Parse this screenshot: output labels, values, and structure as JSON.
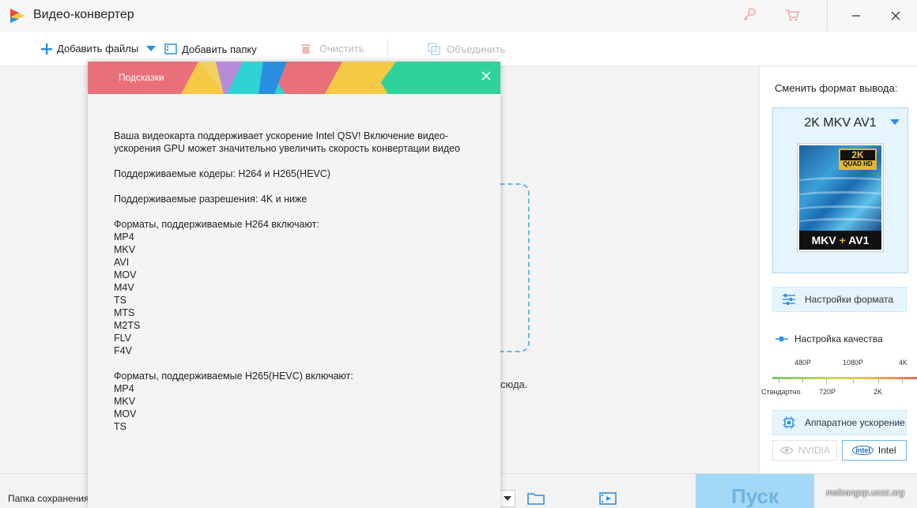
{
  "app": {
    "title": "Видео-конвертер"
  },
  "toolbar": {
    "add_files": "Добавить файлы",
    "add_folder": "Добавить папку",
    "clear": "Очистить",
    "merge": "Объединить"
  },
  "main": {
    "drop_hint_tail": "сюда."
  },
  "dialog": {
    "title": "Подсказки",
    "intro": "Ваша видеокарта поддерживает ускорение Intel QSV! Включение видео-ускорения GPU может значительно увеличить скорость конвертации видео",
    "codecs": "Поддерживаемые кодеры: H264 и H265(HEVC)",
    "resolutions": "Поддерживаемые разрешения: 4K и ниже",
    "h264_heading": "Форматы, поддерживаемые H264 включают:",
    "h264_formats": [
      "MP4",
      "MKV",
      "AVI",
      "MOV",
      "M4V",
      "TS",
      "MTS",
      "M2TS",
      "FLV",
      "F4V"
    ],
    "h265_heading": "Форматы, поддерживаемые H265(HEVC) включают:",
    "h265_formats": [
      "MP4",
      "MKV",
      "MOV",
      "TS"
    ]
  },
  "right_panel": {
    "title": "Сменить формат вывода:",
    "format_name": "2K MKV AV1",
    "thumb": {
      "badge_top": "2K",
      "badge_bottom": "QUAD HD",
      "label_left": "MKV",
      "label_plus": "+",
      "label_right": "AV1"
    },
    "format_settings": "Настройки формата",
    "quality_title": "Настройка качества",
    "quality_top": [
      "480P",
      "1080P",
      "4K"
    ],
    "quality_bottom": [
      "Стандартно",
      "720P",
      "2K"
    ],
    "hw_accel": "Аппаратное ускорение",
    "gpu_nvidia": "NVIDIA",
    "gpu_intel": "Intel",
    "intel_badge": "intel"
  },
  "bottom": {
    "save_folder": "Папка сохранения",
    "start": "Пуск",
    "watermark": "maloangxp.ucoz.org"
  },
  "colors": {
    "accent": "#2b8fe0",
    "dialog_header_red": "#e9707a",
    "dialog_header_green": "#2fd39a"
  }
}
